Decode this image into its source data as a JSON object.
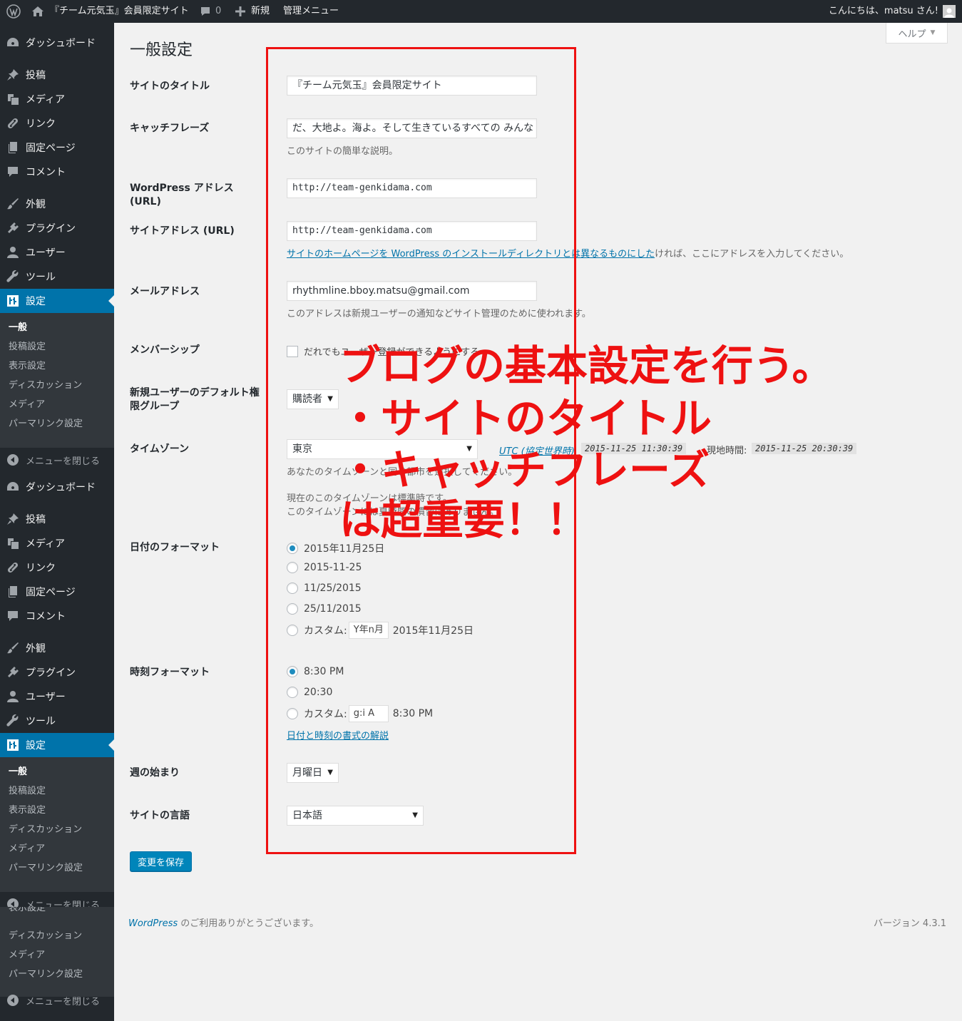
{
  "admin_bar": {
    "site_name": "『チーム元気玉』会員限定サイト",
    "comments_count": "0",
    "new_label": "新規",
    "manage_label": "管理メニュー",
    "greeting": "こんにちは、matsu さん!"
  },
  "sidebar": {
    "menu": {
      "dashboard": "ダッシュボード",
      "posts": "投稿",
      "media": "メディア",
      "links": "リンク",
      "pages": "固定ページ",
      "comments": "コメント",
      "appearance": "外観",
      "plugins": "プラグイン",
      "users": "ユーザー",
      "tools": "ツール",
      "settings": "設定"
    },
    "submenu": {
      "general": "一般",
      "writing": "投稿設定",
      "reading": "表示設定",
      "discussion": "ディスカッション",
      "media": "メディア",
      "permalinks": "パーマリンク設定"
    },
    "collapse": "メニューを閉じる"
  },
  "help_label": "ヘルプ",
  "page_title": "一般設定",
  "form": {
    "site_title": {
      "label": "サイトのタイトル",
      "value": "『チーム元気玉』会員限定サイト"
    },
    "tagline": {
      "label": "キャッチフレーズ",
      "value": "だ、大地よ。海よ。そして生きているすべての みんな",
      "desc": "このサイトの簡単な説明。"
    },
    "wp_url": {
      "label": "WordPress アドレス (URL)",
      "value": "http://team-genkidama.com"
    },
    "site_url": {
      "label": "サイトアドレス (URL)",
      "value": "http://team-genkidama.com",
      "desc_link": "サイトのホームページを WordPress のインストールディレクトリとは異なるものにした",
      "desc_rest": "ければ、ここにアドレスを入力してください。"
    },
    "email": {
      "label": "メールアドレス",
      "value": "rhythmline.bboy.matsu@gmail.com",
      "desc": "このアドレスは新規ユーザーの通知などサイト管理のために使われます。"
    },
    "membership": {
      "label": "メンバーシップ",
      "checkbox_label": "だれでもユーザー登録ができるようにする"
    },
    "default_role": {
      "label": "新規ユーザーのデフォルト権限グループ",
      "value": "購読者"
    },
    "timezone": {
      "label": "タイムゾーン",
      "value": "東京",
      "utc_label": "UTC (協定世界時)",
      "utc_time": "2015-11-25 11:30:39",
      "local_label": "現地時間:",
      "local_time": "2015-11-25 20:30:39",
      "desc": "あなたのタイムゾーンと同じ都市を選択してください。",
      "desc2": "現在のこのタイムゾーンは標準時です。",
      "desc3": "このタイムゾーンには夏時間の慣習はありません。"
    },
    "date_format": {
      "label": "日付のフォーマット",
      "options": [
        "2015年11月25日",
        "2015-11-25",
        "11/25/2015",
        "25/11/2015"
      ],
      "custom_label": "カスタム:",
      "custom_value": "Y年n月",
      "custom_preview": "2015年11月25日"
    },
    "time_format": {
      "label": "時刻フォーマット",
      "options": [
        "8:30 PM",
        "20:30"
      ],
      "custom_label": "カスタム:",
      "custom_value": "g:i A",
      "custom_preview": "8:30 PM",
      "doc_link": "日付と時刻の書式の解説"
    },
    "week_start": {
      "label": "週の始まり",
      "value": "月曜日"
    },
    "language": {
      "label": "サイトの言語",
      "value": "日本語"
    },
    "save_button": "変更を保存"
  },
  "footer": {
    "wp_link": "WordPress",
    "thanks": " のご利用ありがとうございます。",
    "version": "バージョン 4.3.1"
  },
  "annotation": {
    "line1": "ブログの基本設定を行う。",
    "line2": "・サイトのタイトル",
    "line3": "・キャッチフレーズ",
    "line4": "は超重要！！"
  },
  "colors": {
    "admin_bar_bg": "#23282d",
    "accent": "#0073aa",
    "annotation": "#ee1111"
  }
}
